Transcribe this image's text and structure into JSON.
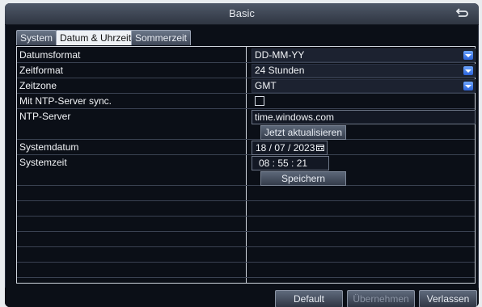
{
  "window": {
    "title": "Basic"
  },
  "tabs": [
    {
      "label": "System",
      "active": false
    },
    {
      "label": "Datum & Uhrzeit",
      "active": true
    },
    {
      "label": "Sommerzeit",
      "active": false
    }
  ],
  "settings": {
    "date_format": {
      "label": "Datumsformat",
      "value": "DD-MM-YY"
    },
    "time_format": {
      "label": "Zeitformat",
      "value": "24 Stunden"
    },
    "time_zone": {
      "label": "Zeitzone",
      "value": "GMT"
    },
    "ntp_sync": {
      "label": "Mit NTP-Server sync.",
      "checked": false
    },
    "ntp_server": {
      "label": "NTP-Server",
      "value": "time.windows.com"
    },
    "update_now_label": "Jetzt aktualisieren",
    "system_date": {
      "label": "Systemdatum",
      "value": "18 / 07 / 2023"
    },
    "system_time": {
      "label": "Systemzeit",
      "value": "08 : 55 : 21"
    },
    "save_label": "Speichern"
  },
  "footer": {
    "default_label": "Default",
    "apply_label": "Übernehmen",
    "exit_label": "Verlassen"
  },
  "colors": {
    "background": "#0b0f17",
    "grid_line": "#cfd5dd",
    "dropdown_arrow": "#2b62d9"
  }
}
